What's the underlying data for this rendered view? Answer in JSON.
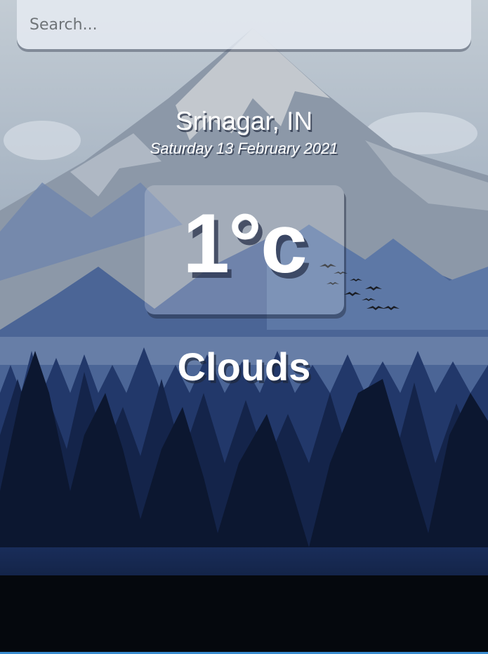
{
  "search": {
    "placeholder": "Search...",
    "value": ""
  },
  "location": "Srinagar, IN",
  "date": "Saturday 13 February 2021",
  "temperature": "1°c",
  "weather": "Clouds",
  "colors": {
    "sky": "#b9c3cd",
    "mountain": "#8d98a6",
    "forest_dark": "#0b1424",
    "accent_line": "#3a8ccf"
  }
}
